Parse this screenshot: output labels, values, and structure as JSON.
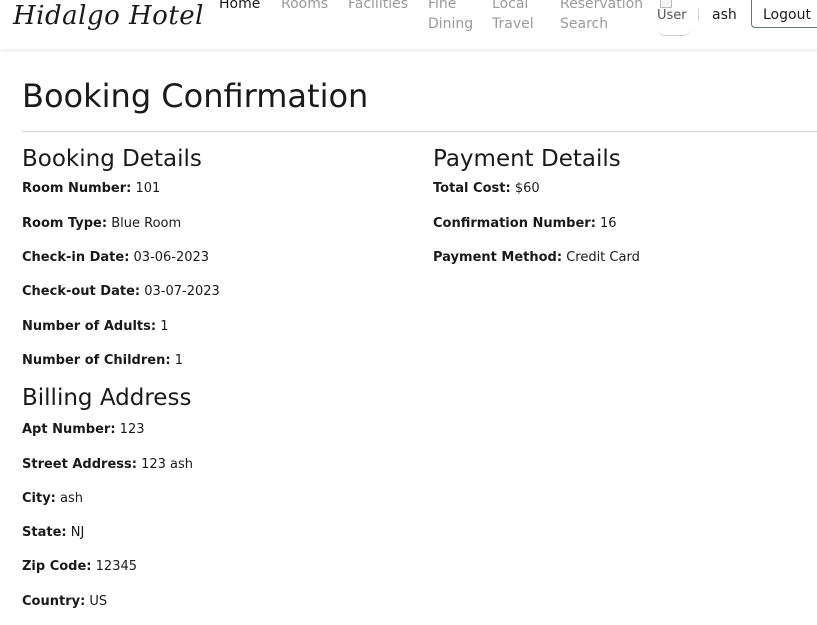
{
  "navbar": {
    "brand": "Hidalgo Hotel",
    "links": [
      {
        "line1": "Home",
        "line2": ""
      },
      {
        "line1": "Rooms",
        "line2": ""
      },
      {
        "line1": "Facilities",
        "line2": ""
      },
      {
        "line1": "Fine",
        "line2": "Dining"
      },
      {
        "line1": "Local",
        "line2": "Travel"
      },
      {
        "line1": "Reservation",
        "line2": "Search"
      }
    ],
    "user_image_alt": "User",
    "username": "ash",
    "logout_label": "Logout"
  },
  "page": {
    "title": "Booking Confirmation"
  },
  "booking_details": {
    "heading": "Booking Details",
    "fields": [
      {
        "label": "Room Number:",
        "value": "101"
      },
      {
        "label": "Room Type:",
        "value": "Blue Room"
      },
      {
        "label": "Check-in Date:",
        "value": "03-06-2023"
      },
      {
        "label": "Check-out Date:",
        "value": "03-07-2023"
      },
      {
        "label": "Number of Adults:",
        "value": "1"
      },
      {
        "label": "Number of Children:",
        "value": "1"
      }
    ]
  },
  "payment_details": {
    "heading": "Payment Details",
    "fields": [
      {
        "label": "Total Cost:",
        "value": "$60"
      },
      {
        "label": "Confirmation Number:",
        "value": "16"
      },
      {
        "label": "Payment Method:",
        "value": "Credit Card"
      }
    ]
  },
  "billing_address": {
    "heading": "Billing Address",
    "fields": [
      {
        "label": "Apt Number:",
        "value": "123"
      },
      {
        "label": "Street Address:",
        "value": "123 ash"
      },
      {
        "label": "City:",
        "value": "ash"
      },
      {
        "label": "State:",
        "value": "NJ"
      },
      {
        "label": "Zip Code:",
        "value": "12345"
      },
      {
        "label": "Country:",
        "value": "US"
      }
    ]
  }
}
